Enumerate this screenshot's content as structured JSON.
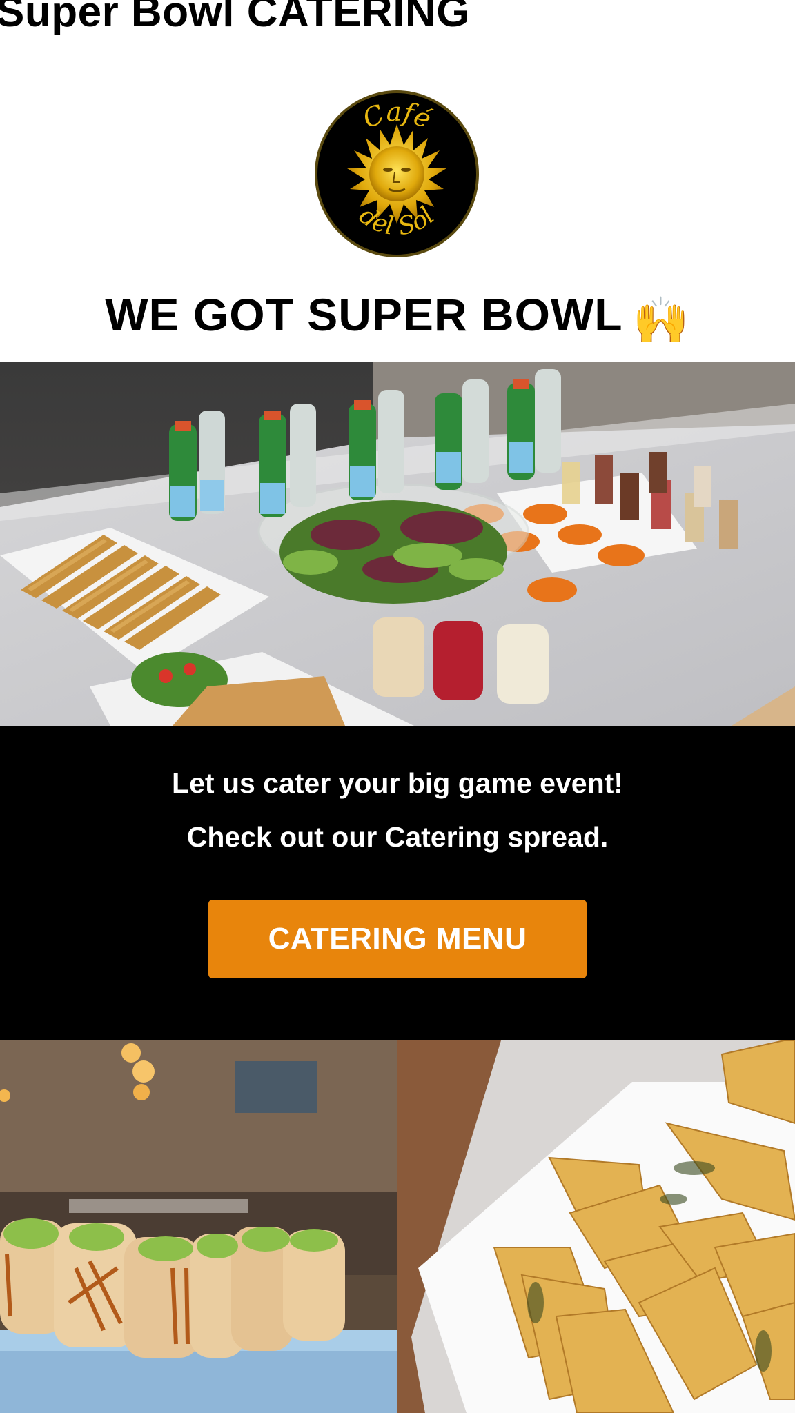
{
  "page": {
    "title": "Super Bowl CATERING"
  },
  "logo": {
    "top_text": "Café",
    "bottom_text": "del Sol"
  },
  "headline": {
    "text": "WE GOT SUPER BOWL",
    "emoji": "🙌"
  },
  "promo": {
    "line1": "Let us cater your big game event!",
    "line2": "Check out our Catering spread.",
    "cta_label": "CATERING MENU"
  },
  "colors": {
    "cta_background": "#e8850c",
    "band_background": "#000000",
    "logo_gold": "#e8b810"
  },
  "images": {
    "hero": "catering-spread-photo",
    "left": "wraps-platter-photo",
    "right": "quesadilla-platter-photo"
  }
}
